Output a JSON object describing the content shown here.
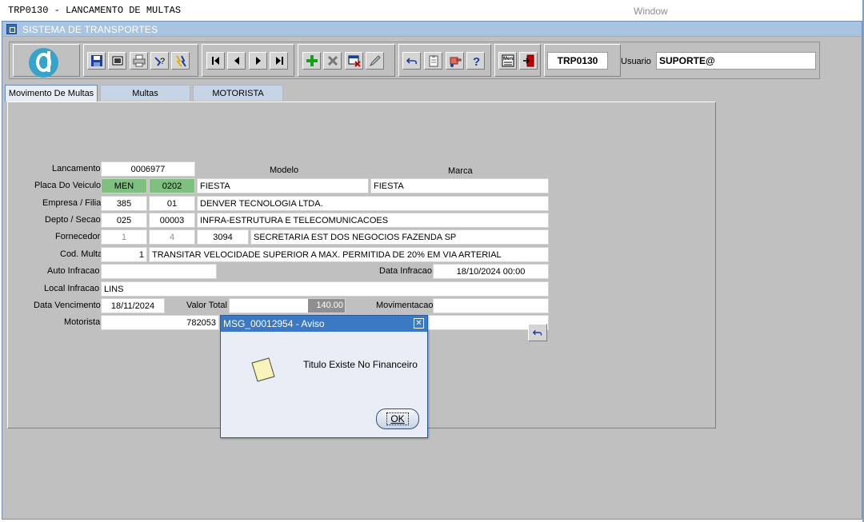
{
  "app": {
    "title": "TRP0130 - LANCAMENTO DE MULTAS",
    "menu_window": "Window"
  },
  "mdi": {
    "title": "SISTEMA DE TRANSPORTES"
  },
  "toolbar": {
    "form_id": "TRP0130",
    "user_label": "Usuario",
    "user_value": "SUPORTE@"
  },
  "tabs": [
    {
      "label": "Movimento De Multas",
      "active": true
    },
    {
      "label": "Multas",
      "active": false
    },
    {
      "label": "MOTORISTA",
      "active": false
    }
  ],
  "form": {
    "lancamento_label": "Lancamento",
    "lancamento": "0006977",
    "modelo_header": "Modelo",
    "marca_header": "Marca",
    "placa_label": "Placa Do Veiculo",
    "placa_letters": "MEN",
    "placa_numbers": "0202",
    "modelo": "FIESTA",
    "marca": "FIESTA",
    "empresa_label": "Empresa / Filial",
    "empresa": "385",
    "filial": "01",
    "empresa_nome": "DENVER TECNOLOGIA LTDA.",
    "depto_label": "Depto / Secao",
    "depto": "025",
    "secao": "00003",
    "depto_nome": "INFRA-ESTRUTURA E TELECOMUNICACOES",
    "fornecedor_label": "Fornecedor",
    "fornecedor_1": "1",
    "fornecedor_2": "4",
    "fornecedor_codigo": "3094",
    "fornecedor_nome": "SECRETARIA EST DOS NEGOCIOS FAZENDA SP",
    "cod_multa_label": "Cod. Multa",
    "cod_multa": "1",
    "cod_multa_desc": "TRANSITAR VELOCIDADE SUPERIOR A MAX. PERMITIDA DE 20% EM VIA ARTERIAL",
    "auto_label": "Auto Infracao",
    "auto": "",
    "data_infracao_label": "Data Infracao",
    "data_infracao": "18/10/2024 00:00",
    "local_label": "Local Infracao",
    "local": "LINS",
    "vencimento_label": "Data Vencimento",
    "vencimento": "18/11/2024",
    "valor_label": "Valor Total",
    "valor_total": "140.00",
    "movimentacao_label": "Movimentacao",
    "movimentacao": "",
    "motorista_label": "Motorista",
    "motorista": "782053"
  },
  "dialog": {
    "title": "MSG_00012954 - Aviso",
    "message": "Titulo Existe No Financeiro",
    "ok_label": "OK"
  }
}
